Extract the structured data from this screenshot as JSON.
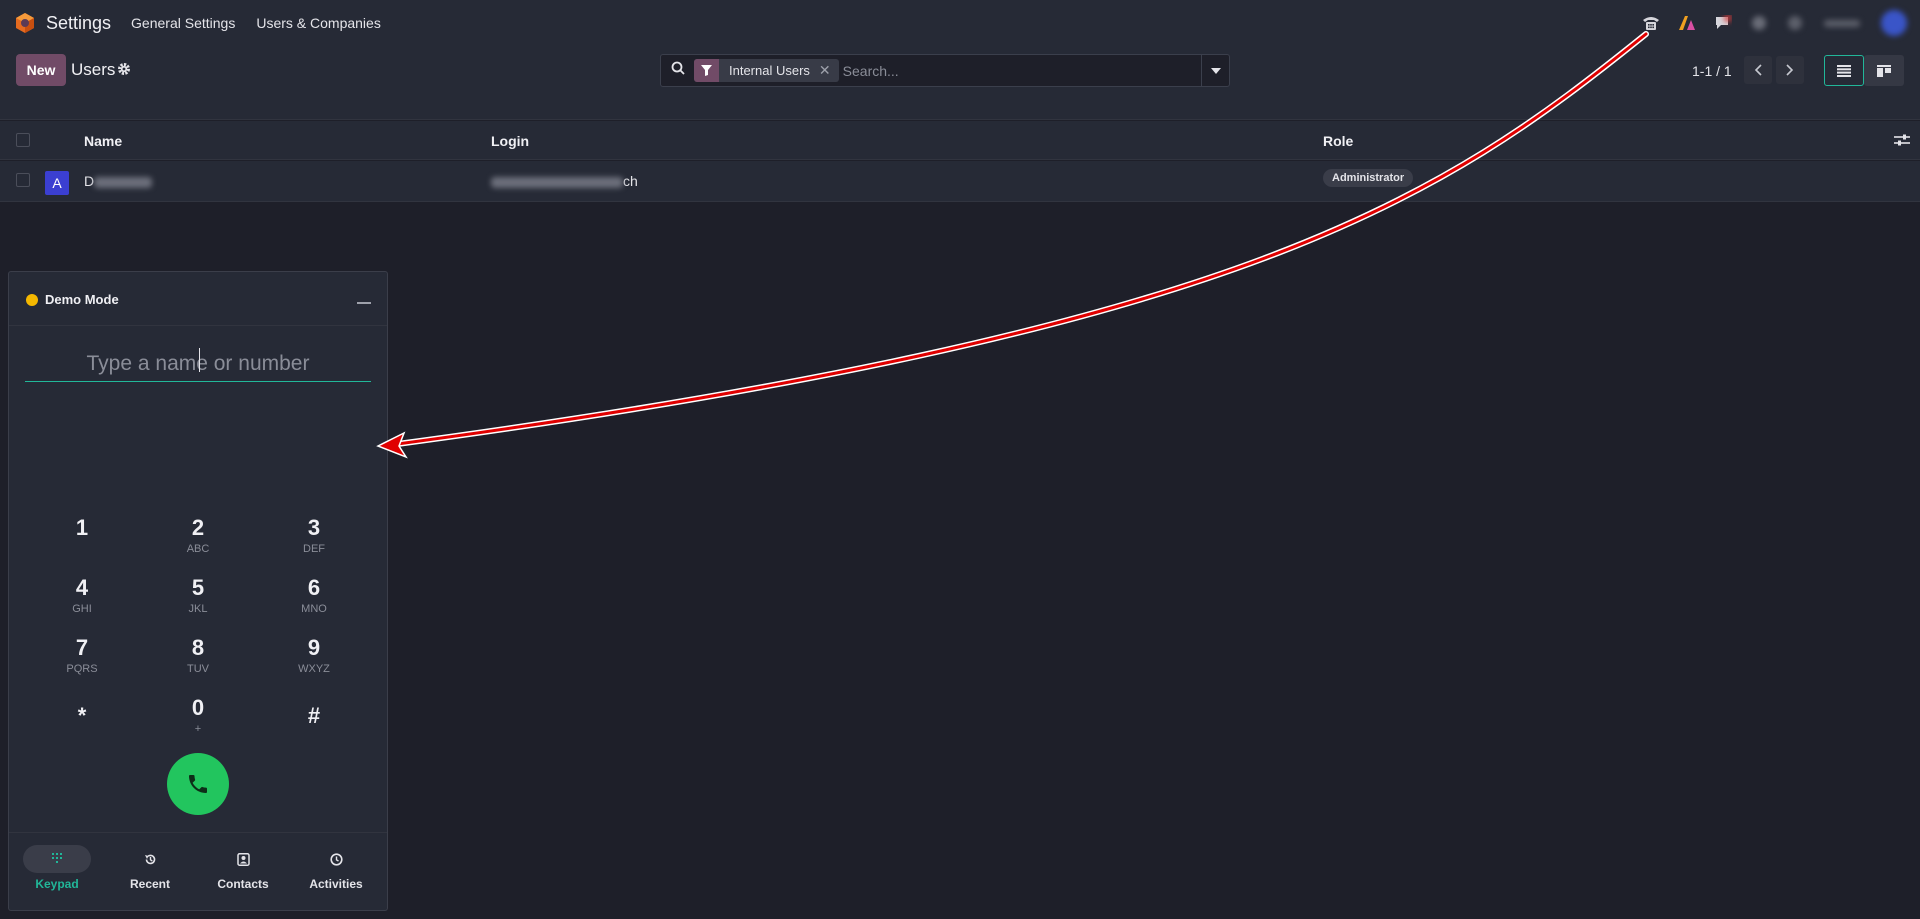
{
  "navbar": {
    "app_name": "Settings",
    "menus": [
      "General Settings",
      "Users & Companies"
    ],
    "systray_icons": [
      "phone-icon",
      "ai-icon",
      "chat-icon",
      "activity-icon",
      "clock-icon",
      "company-icon",
      "user-avatar"
    ]
  },
  "control_panel": {
    "new_label": "New",
    "title": "Users",
    "search": {
      "facet_label": "Internal Users",
      "placeholder": "Search..."
    },
    "pager": "1-1 / 1"
  },
  "list": {
    "columns": [
      "Name",
      "Login",
      "Role"
    ],
    "rows": [
      {
        "avatar_letter": "A",
        "name_visible": "D",
        "login_visible": "ch",
        "role": "Administrator"
      }
    ]
  },
  "softphone": {
    "title": "Demo Mode",
    "status_color": "#f5b800",
    "input_placeholder": "Type a name or number",
    "keys": [
      {
        "digit": "1",
        "letters": ""
      },
      {
        "digit": "2",
        "letters": "ABC"
      },
      {
        "digit": "3",
        "letters": "DEF"
      },
      {
        "digit": "4",
        "letters": "GHI"
      },
      {
        "digit": "5",
        "letters": "JKL"
      },
      {
        "digit": "6",
        "letters": "MNO"
      },
      {
        "digit": "7",
        "letters": "PQRS"
      },
      {
        "digit": "8",
        "letters": "TUV"
      },
      {
        "digit": "9",
        "letters": "WXYZ"
      },
      {
        "digit": "*",
        "letters": ""
      },
      {
        "digit": "0",
        "letters": "+"
      },
      {
        "digit": "#",
        "letters": ""
      }
    ],
    "tabs": [
      {
        "label": "Keypad",
        "icon": "keypad-icon",
        "active": true
      },
      {
        "label": "Recent",
        "icon": "history-icon",
        "active": false
      },
      {
        "label": "Contacts",
        "icon": "contacts-icon",
        "active": false
      },
      {
        "label": "Activities",
        "icon": "clock-icon",
        "active": false
      }
    ]
  },
  "colors": {
    "accent": "#21b799",
    "brand": "#714b67",
    "call": "#22c55e",
    "annotation_arrow": "#e00000"
  }
}
